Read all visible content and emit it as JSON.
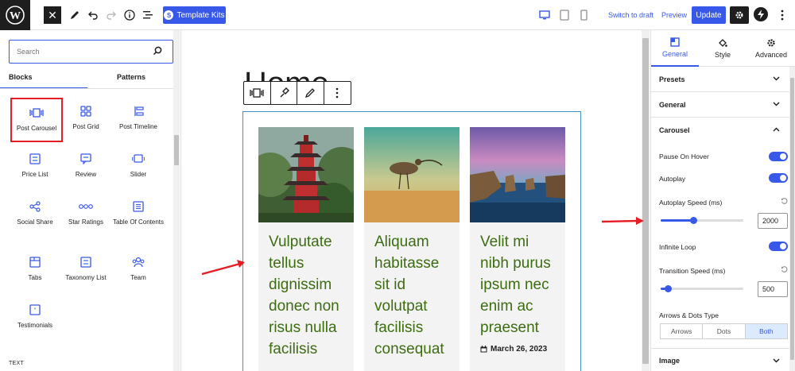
{
  "topbar": {
    "template_kits_label": "Template Kits",
    "switch_to_draft": "Switch to draft",
    "preview": "Preview",
    "update": "Update"
  },
  "inserter": {
    "search_placeholder": "Search",
    "tabs": [
      {
        "label": "Blocks"
      },
      {
        "label": "Patterns"
      }
    ],
    "blocks": [
      {
        "label": "Post Carousel",
        "icon": "post-carousel-icon"
      },
      {
        "label": "Post Grid",
        "icon": "post-grid-icon"
      },
      {
        "label": "Post Timeline",
        "icon": "post-timeline-icon"
      },
      {
        "label": "Price List",
        "icon": "price-list-icon"
      },
      {
        "label": "Review",
        "icon": "review-icon"
      },
      {
        "label": "Slider",
        "icon": "slider-icon"
      },
      {
        "label": "Social Share",
        "icon": "social-share-icon"
      },
      {
        "label": "Star Ratings",
        "icon": "star-ratings-icon"
      },
      {
        "label": "Table Of Contents",
        "icon": "table-of-contents-icon"
      },
      {
        "label": "Tabs",
        "icon": "tabs-icon"
      },
      {
        "label": "Taxonomy List",
        "icon": "taxonomy-list-icon"
      },
      {
        "label": "Team",
        "icon": "team-icon"
      },
      {
        "label": "Testimonials",
        "icon": "testimonials-icon"
      }
    ],
    "section_label": "TEXT"
  },
  "canvas": {
    "page_title": "Home",
    "cards": [
      {
        "title": "Vulputate tellus dignissim donec non risus nulla facilisis",
        "image": "pagoda-image"
      },
      {
        "title": "Aliquam habitasse sit id volutpat facilisis consequat",
        "image": "bird-on-beach-image"
      },
      {
        "title": "Velit mi nibh purus ipsum nec enim ac praesent",
        "image": "sea-rocks-image",
        "date": "March 26, 2023"
      }
    ]
  },
  "settings": {
    "tabs": [
      {
        "label": "General"
      },
      {
        "label": "Style"
      },
      {
        "label": "Advanced"
      }
    ],
    "sections": {
      "presets": "Presets",
      "general": "General",
      "carousel": "Carousel",
      "image": "Image"
    },
    "carousel": {
      "pause_on_hover": "Pause On Hover",
      "autoplay": "Autoplay",
      "autoplay_speed_label": "Autoplay Speed (ms)",
      "autoplay_speed": "2000",
      "infinite_loop": "Infinite Loop",
      "transition_speed_label": "Transition Speed (ms)",
      "transition_speed": "500",
      "arrows_dots_label": "Arrows & Dots Type",
      "arrows_dots_options": [
        "Arrows",
        "Dots",
        "Both"
      ],
      "arrows_dots_selected": "Both"
    }
  },
  "colors": {
    "accent": "#3858e9",
    "card_title": "#3c6d11",
    "highlight_red": "#e51e25"
  }
}
